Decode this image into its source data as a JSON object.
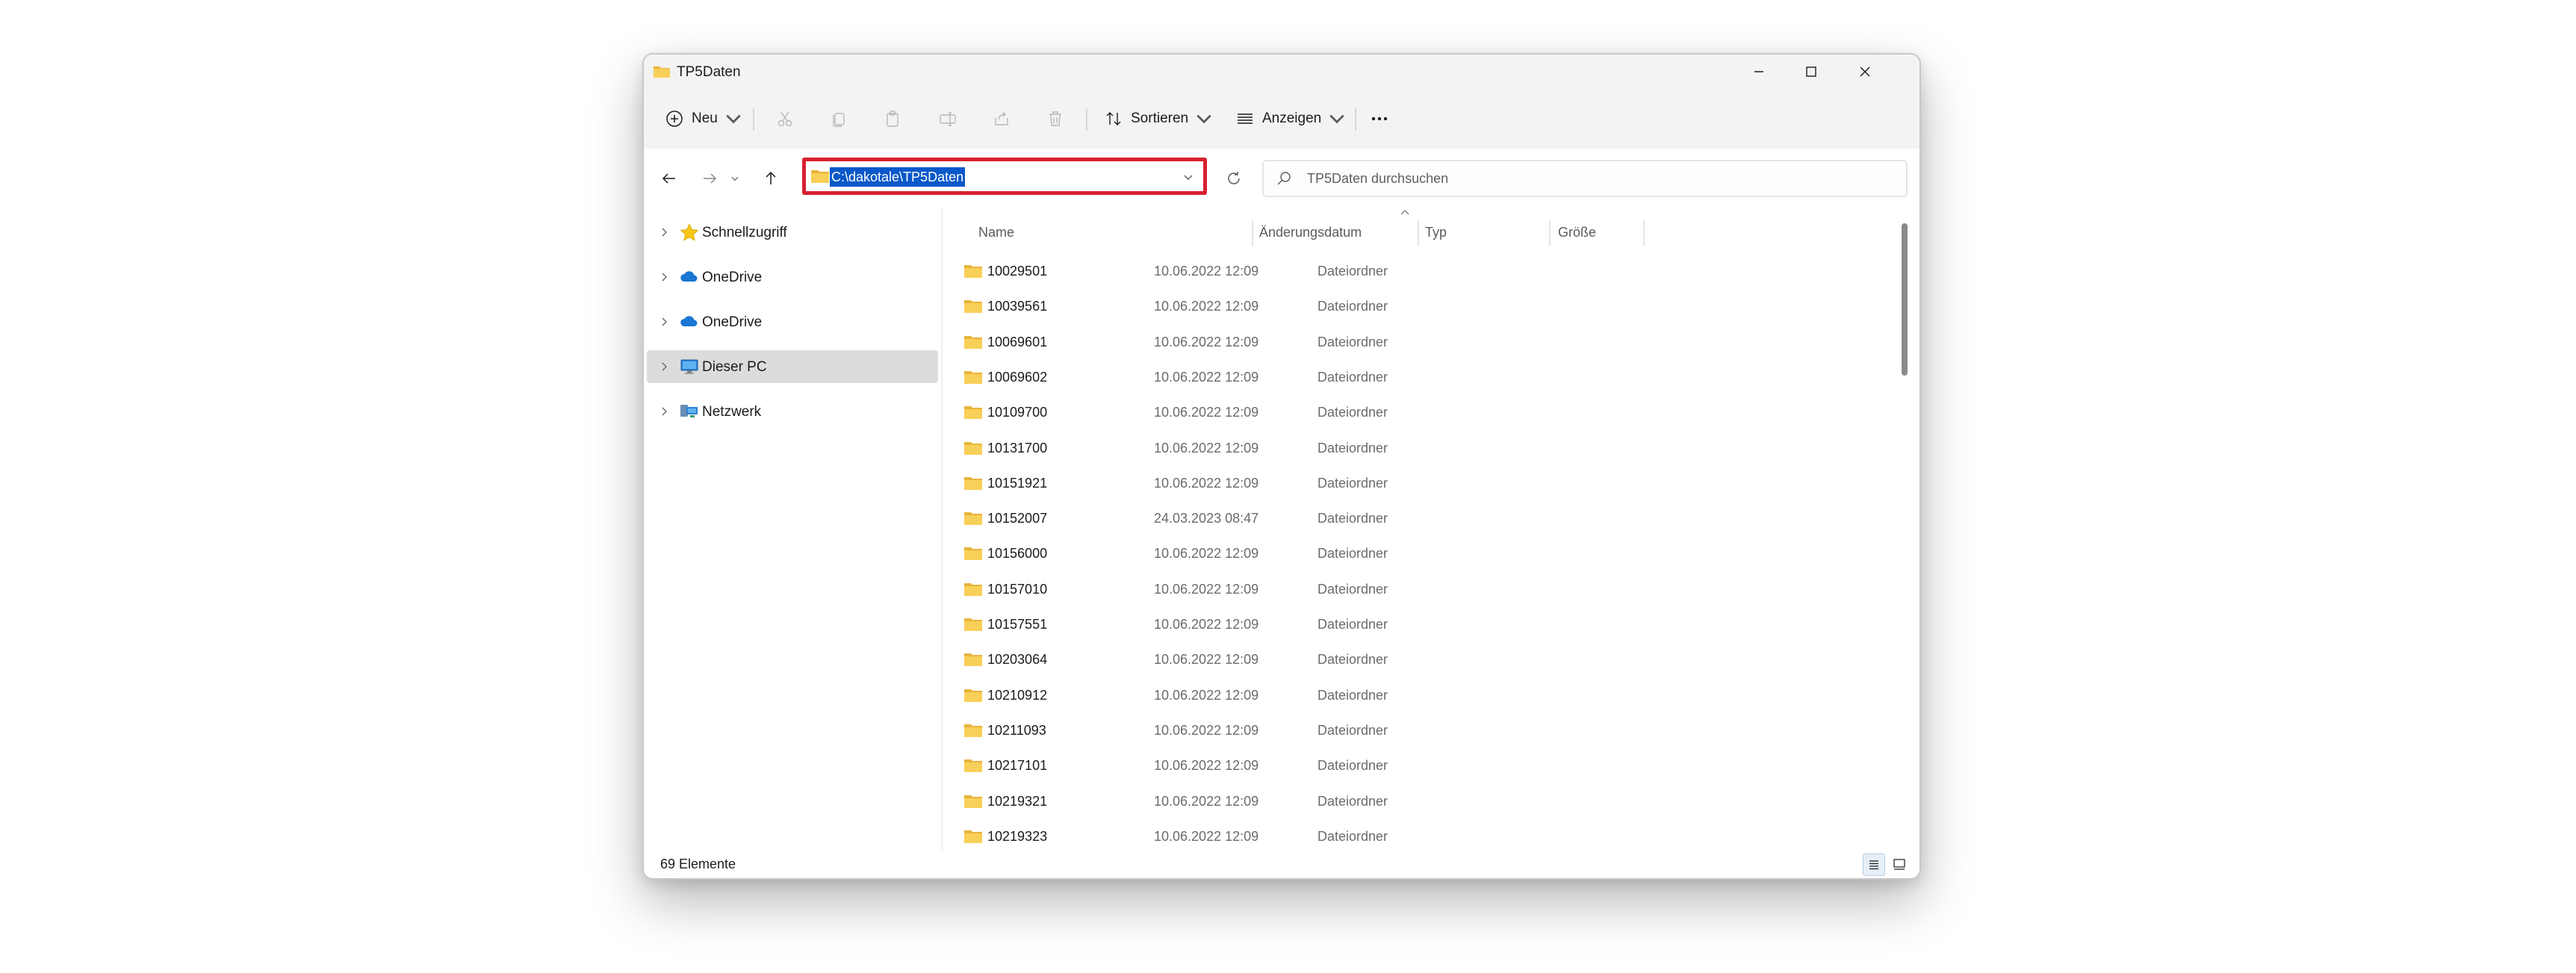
{
  "window": {
    "title": "TP5Daten",
    "controls": [
      "minimize-icon",
      "maximize-icon",
      "close-icon"
    ]
  },
  "toolbar": {
    "new_label": "Neu",
    "sort_label": "Sortieren",
    "view_label": "Anzeigen",
    "disabled_icons": [
      "cut-icon",
      "copy-icon",
      "paste-icon",
      "rename-icon",
      "share-icon",
      "delete-icon"
    ],
    "more_icon": "more-icon"
  },
  "address": {
    "path": "C:\\dakotale\\TP5Daten",
    "highlight_color": "#d6212f",
    "selection_color": "#0a58c9"
  },
  "search": {
    "placeholder": "TP5Daten durchsuchen"
  },
  "sidebar": {
    "items": [
      {
        "label": "Schnellzugriff",
        "icon": "star-icon",
        "selected": false
      },
      {
        "label": "OneDrive",
        "icon": "cloud-icon",
        "selected": false
      },
      {
        "label": "OneDrive",
        "icon": "cloud-icon",
        "selected": false
      },
      {
        "label": "Dieser PC",
        "icon": "computer-icon",
        "selected": true
      },
      {
        "label": "Netzwerk",
        "icon": "network-icon",
        "selected": false
      }
    ]
  },
  "columns": {
    "name": "Name",
    "date": "Änderungsdatum",
    "type": "Typ",
    "size": "Größe"
  },
  "files": [
    {
      "name": "10029501",
      "date": "10.06.2022 12:09",
      "type": "Dateiordner"
    },
    {
      "name": "10039561",
      "date": "10.06.2022 12:09",
      "type": "Dateiordner"
    },
    {
      "name": "10069601",
      "date": "10.06.2022 12:09",
      "type": "Dateiordner"
    },
    {
      "name": "10069602",
      "date": "10.06.2022 12:09",
      "type": "Dateiordner"
    },
    {
      "name": "10109700",
      "date": "10.06.2022 12:09",
      "type": "Dateiordner"
    },
    {
      "name": "10131700",
      "date": "10.06.2022 12:09",
      "type": "Dateiordner"
    },
    {
      "name": "10151921",
      "date": "10.06.2022 12:09",
      "type": "Dateiordner"
    },
    {
      "name": "10152007",
      "date": "24.03.2023 08:47",
      "type": "Dateiordner"
    },
    {
      "name": "10156000",
      "date": "10.06.2022 12:09",
      "type": "Dateiordner"
    },
    {
      "name": "10157010",
      "date": "10.06.2022 12:09",
      "type": "Dateiordner"
    },
    {
      "name": "10157551",
      "date": "10.06.2022 12:09",
      "type": "Dateiordner"
    },
    {
      "name": "10203064",
      "date": "10.06.2022 12:09",
      "type": "Dateiordner"
    },
    {
      "name": "10210912",
      "date": "10.06.2022 12:09",
      "type": "Dateiordner"
    },
    {
      "name": "10211093",
      "date": "10.06.2022 12:09",
      "type": "Dateiordner"
    },
    {
      "name": "10217101",
      "date": "10.06.2022 12:09",
      "type": "Dateiordner"
    },
    {
      "name": "10219321",
      "date": "10.06.2022 12:09",
      "type": "Dateiordner"
    },
    {
      "name": "10219323",
      "date": "10.06.2022 12:09",
      "type": "Dateiordner"
    }
  ],
  "status": {
    "count_text": "69 Elemente"
  }
}
